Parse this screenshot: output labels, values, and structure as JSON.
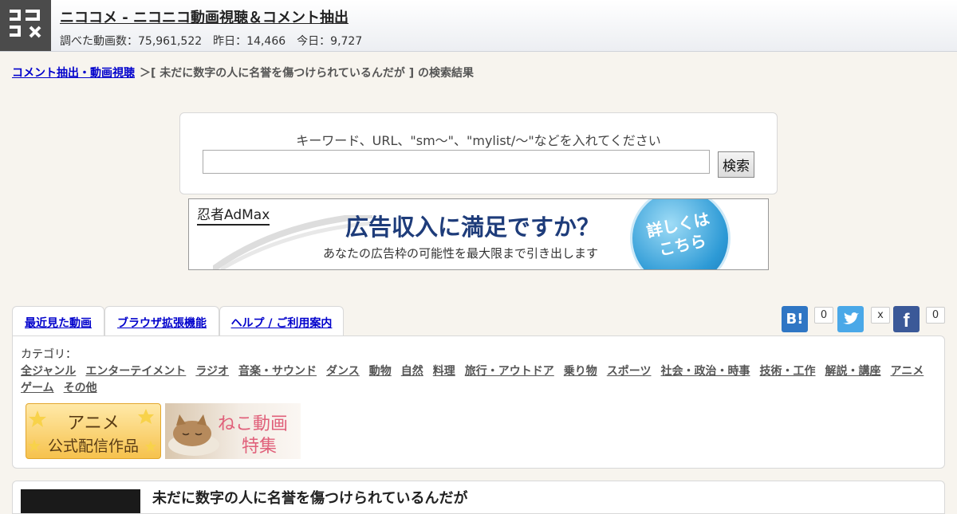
{
  "header": {
    "title": "ニココメ - ニコニコ動画視聴＆コメント抽出",
    "stats": {
      "investigated": "調べた動画数：75,961,522",
      "yesterday": "昨日：14,466",
      "today": "今日：9,727"
    }
  },
  "breadcrumb": {
    "link": "コメント抽出・動画視聴",
    "rest": "＞[ 未だに数字の人に名誉を傷つけられているんだが ] の検索結果"
  },
  "search": {
    "hint": "キーワード、URL、\"sm〜\"、\"mylist/〜\"などを入れてください",
    "value": "",
    "button": "検索"
  },
  "ad": {
    "logo": "忍者AdMax",
    "headline": "広告収入に満足ですか？",
    "sub": "あなたの広告枠の可能性を最大限まで引き出します",
    "circle_line1": "詳しくは",
    "circle_line2": "こちら"
  },
  "tabs": [
    "最近見た動画",
    "ブラウザ拡張機能",
    "ヘルプ / ご利用案内"
  ],
  "social": {
    "hatena_label": "B!",
    "hatena_count": "0",
    "twitter_count": "x",
    "facebook_label": "f",
    "facebook_count": "0"
  },
  "categories": {
    "label": "カテゴリ：",
    "row1": [
      "全ジャンル",
      "エンターテイメント",
      "ラジオ",
      "音楽・サウンド",
      "ダンス",
      "動物",
      "自然",
      "料理",
      "旅行・アウトドア",
      "乗り物",
      "スポーツ",
      "社会・政治・時事",
      "技術・工作",
      "解説・講座",
      "アニメ"
    ],
    "row2": [
      "ゲーム",
      "その他"
    ]
  },
  "promos": {
    "anime_line1": "アニメ",
    "anime_line2": "公式配信作品",
    "cat_line1": "ねこ動画",
    "cat_line2": "特集"
  },
  "result": {
    "title": "未だに数字の人に名誉を傷つけられているんだが"
  },
  "colors": {
    "background": "#f7f4ee",
    "link": "#0000cc",
    "hatena": "#2f76c4",
    "twitter": "#4aa8e8",
    "facebook": "#3b5998"
  }
}
